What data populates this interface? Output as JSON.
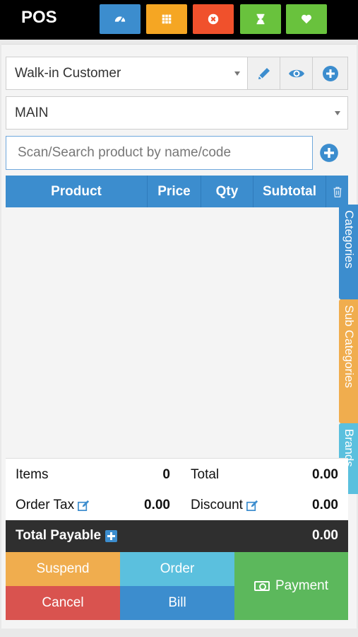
{
  "header": {
    "brand": "POS",
    "buttons": [
      {
        "icon": "dashboard-icon",
        "color": "#3c8dce"
      },
      {
        "icon": "grid-icon",
        "color": "#f5a623"
      },
      {
        "icon": "close-circle-icon",
        "color": "#f0512c"
      },
      {
        "icon": "hourglass-icon",
        "color": "#69c23d"
      },
      {
        "icon": "heart-icon",
        "color": "#69c23d"
      }
    ]
  },
  "customer": {
    "value": "Walk-in Customer"
  },
  "warehouse": {
    "value": "MAIN"
  },
  "search": {
    "placeholder": "Scan/Search product by name/code"
  },
  "table": {
    "columns": [
      "Product",
      "Price",
      "Qty",
      "Subtotal"
    ]
  },
  "side_tabs": [
    "Categories",
    "Sub Categories",
    "Brands"
  ],
  "totals": {
    "items_label": "Items",
    "items_value": "0",
    "total_label": "Total",
    "total_value": "0.00",
    "order_tax_label": "Order Tax",
    "order_tax_value": "0.00",
    "discount_label": "Discount",
    "discount_value": "0.00",
    "payable_label": "Total Payable",
    "payable_value": "0.00"
  },
  "actions": {
    "suspend": "Suspend",
    "order": "Order",
    "payment": "Payment",
    "cancel": "Cancel",
    "bill": "Bill"
  },
  "colors": {
    "primary": "#3c8dce",
    "warning": "#f0ad4e",
    "info": "#5bc0de",
    "danger": "#d9534f",
    "success": "#5cb85c",
    "dark": "#2f2f2f"
  }
}
